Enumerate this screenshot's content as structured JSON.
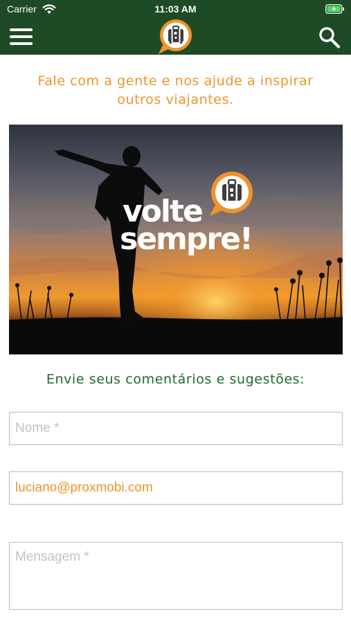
{
  "status_bar": {
    "carrier": "Carrier",
    "time": "11:03 AM",
    "icons": [
      "wifi-icon",
      "battery-charging-icon"
    ]
  },
  "nav": {
    "menu_icon": "hamburger-menu-icon",
    "logo_icon": "suitcase-speech-bubble-logo",
    "search_icon": "search-icon"
  },
  "headline": {
    "text": "Fale com a gente e nos ajude a inspirar outros viajantes."
  },
  "hero": {
    "line1": "volte",
    "line2": "sempre!",
    "logo_icon": "suitcase-speech-bubble-logo"
  },
  "form": {
    "heading": "Envie seus comentários e sugestões:",
    "name_placeholder": "Nome *",
    "email_value": "luciano@proxmobi.com",
    "message_placeholder": "Mensagem *"
  },
  "colors": {
    "header_bg": "#1f4a26",
    "accent_orange": "#f0932a",
    "heading_green": "#1f6a2a",
    "field_border": "#b9b9b9"
  }
}
